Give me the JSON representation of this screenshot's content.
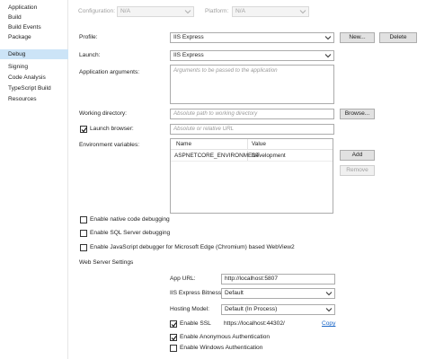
{
  "nav": {
    "items": [
      {
        "label": "Application",
        "selected": false
      },
      {
        "label": "Build",
        "selected": false
      },
      {
        "label": "Build Events",
        "selected": false
      },
      {
        "label": "Package",
        "selected": false
      },
      {
        "label": "Debug",
        "selected": true
      },
      {
        "label": "Signing",
        "selected": false
      },
      {
        "label": "Code Analysis",
        "selected": false
      },
      {
        "label": "TypeScript Build",
        "selected": false
      },
      {
        "label": "Resources",
        "selected": false
      }
    ]
  },
  "top": {
    "configuration_label": "Configuration:",
    "configuration_value": "N/A",
    "platform_label": "Platform:",
    "platform_value": "N/A"
  },
  "profile": {
    "label": "Profile:",
    "value": "IIS Express",
    "new_button": "New...",
    "delete_button": "Delete"
  },
  "launch": {
    "label": "Launch:",
    "value": "IIS Express"
  },
  "app_args": {
    "label": "Application arguments:",
    "placeholder": "Arguments to be passed to the application"
  },
  "working_dir": {
    "label": "Working directory:",
    "placeholder": "Absolute path to working directory",
    "browse_button": "Browse..."
  },
  "launch_browser": {
    "label": "Launch browser:",
    "checked": true,
    "placeholder": "Absolute or relative URL"
  },
  "env": {
    "label": "Environment variables:",
    "col_name": "Name",
    "col_value": "Value",
    "rows": [
      {
        "name": "ASPNETCORE_ENVIRONMENT",
        "value": "Development"
      }
    ],
    "add_button": "Add",
    "remove_button": "Remove"
  },
  "debug_options": [
    {
      "label": "Enable native code debugging",
      "checked": false
    },
    {
      "label": "Enable SQL Server debugging",
      "checked": false
    },
    {
      "label": "Enable JavaScript debugger for Microsoft Edge (Chromium) based WebView2",
      "checked": false
    }
  ],
  "web_server": {
    "section_label": "Web Server Settings",
    "app_url_label": "App URL:",
    "app_url_value": "http://localhost:5807",
    "bitness_label": "IIS Express Bitness:",
    "bitness_value": "Default",
    "hosting_label": "Hosting Model:",
    "hosting_value": "Default (In Process)",
    "ssl_label": "Enable SSL",
    "ssl_checked": true,
    "ssl_url": "https://localhost:44302/",
    "copy_link": "Copy",
    "anon_label": "Enable Anonymous Authentication",
    "anon_checked": true,
    "windows_label": "Enable Windows Authentication",
    "windows_checked": false
  },
  "colors": {
    "nav_selected": "#cce4f7",
    "link": "#1a66c7",
    "border": "#ababab",
    "button_bg": "#e1e1e1"
  }
}
